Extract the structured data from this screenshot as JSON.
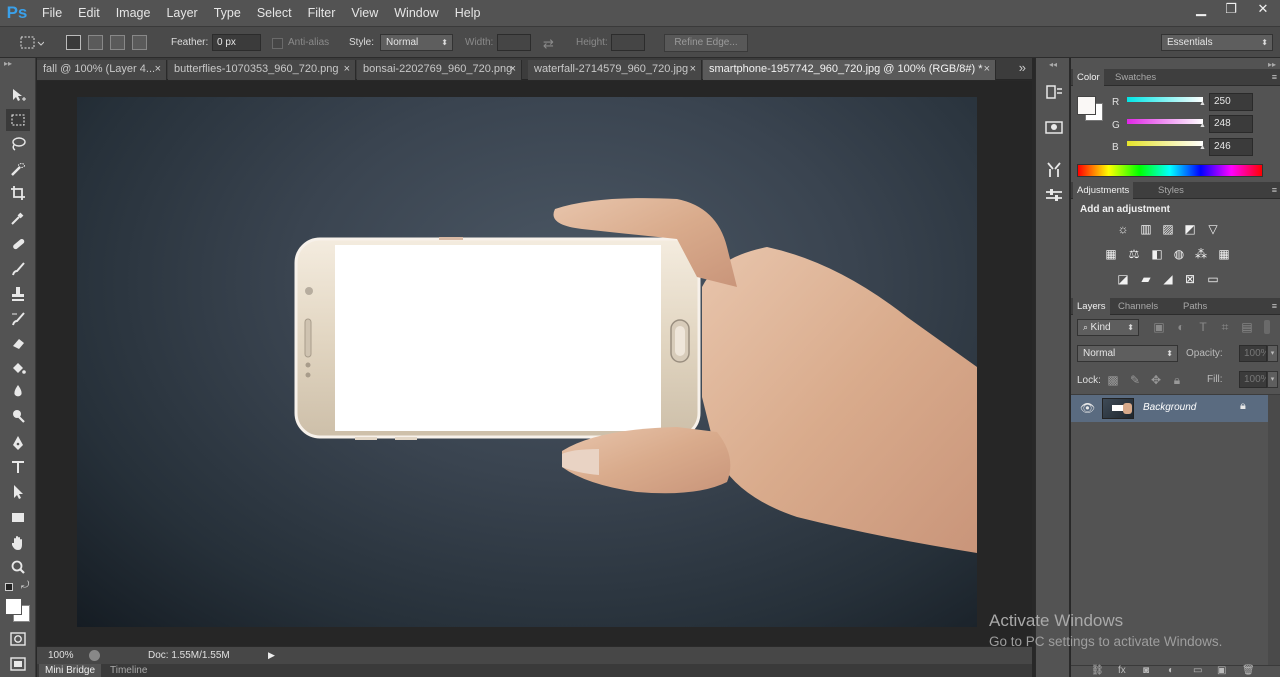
{
  "app": {
    "logo": "Ps"
  },
  "menu": [
    "File",
    "Edit",
    "Image",
    "Layer",
    "Type",
    "Select",
    "Filter",
    "View",
    "Window",
    "Help"
  ],
  "window_controls": {
    "minimize": "▁",
    "restore": "❐",
    "close": "✕"
  },
  "options": {
    "feather_label": "Feather:",
    "feather_value": "0 px",
    "antialias_label": "Anti-alias",
    "style_label": "Style:",
    "style_value": "Normal",
    "width_label": "Width:",
    "height_label": "Height:",
    "refine_label": "Refine Edge...",
    "workspace": "Essentials"
  },
  "tabs": [
    {
      "label": "fall @ 100% (Layer 4..."
    },
    {
      "label": "butterflies-1070353_960_720.png"
    },
    {
      "label": "bonsai-2202769_960_720.png"
    },
    {
      "label": "waterfall-2714579_960_720.jpg"
    },
    {
      "label": "smartphone-1957742_960_720.jpg @ 100% (RGB/8#) *"
    }
  ],
  "tab_close": "×",
  "tab_overflow": "»",
  "status": {
    "zoom": "100%",
    "doc": "Doc: 1.55M/1.55M"
  },
  "bottom_tabs": {
    "mini_bridge": "Mini Bridge",
    "timeline": "Timeline"
  },
  "color_panel": {
    "tabs": [
      "Color",
      "Swatches"
    ],
    "channels": [
      {
        "label": "R",
        "value": "250",
        "color": "#22d6e0"
      },
      {
        "label": "G",
        "value": "248",
        "color": "#e03ae6"
      },
      {
        "label": "B",
        "value": "246",
        "color": "#e6e42a"
      }
    ],
    "foreground": "#faf8f6"
  },
  "adjustments_panel": {
    "tabs": [
      "Adjustments",
      "Styles"
    ],
    "title": "Add an adjustment"
  },
  "layers_panel": {
    "tabs": [
      "Layers",
      "Channels",
      "Paths"
    ],
    "filter_kind": "Kind",
    "blend_mode": "Normal",
    "opacity_label": "Opacity:",
    "opacity_value": "100%",
    "lock_label": "Lock:",
    "fill_label": "Fill:",
    "fill_value": "100%",
    "layers": [
      {
        "name": "Background"
      }
    ]
  },
  "watermark": {
    "title": "Activate Windows",
    "subtitle": "Go to PC settings to activate Windows."
  },
  "colors": {
    "accent": "#3aa0ea",
    "layer_selected": "#5a6b80"
  }
}
